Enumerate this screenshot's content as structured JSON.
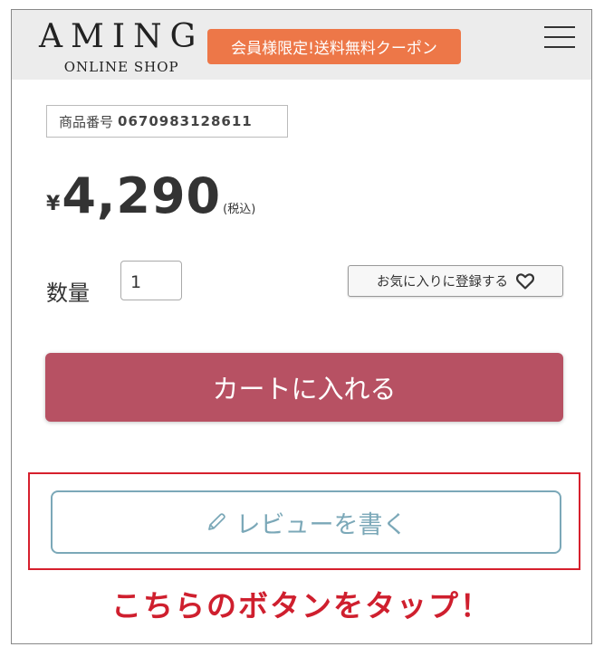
{
  "header": {
    "logo_main": "AMING",
    "logo_sub": "ONLINE SHOP",
    "coupon_label": "会員様限定!送料無料クーポン",
    "coupon_color": "#ed7748",
    "menu_icon": "hamburger-menu-icon"
  },
  "product": {
    "sku_label": "商品番号",
    "sku_value": "0670983128611",
    "price_currency": "¥",
    "price_value": "4,290",
    "price_tax": "(税込)"
  },
  "quantity": {
    "label": "数量",
    "value": "1"
  },
  "favorite": {
    "label": "お気に入りに登録する",
    "icon": "heart-icon"
  },
  "cart": {
    "label": "カートに入れる",
    "color": "#b75163"
  },
  "review": {
    "label": "レビューを書く",
    "icon": "pencil-icon",
    "border_color": "#7ba8b8"
  },
  "annotation": {
    "callout": "こちらのボタンをタップ！",
    "highlight_color": "#d6202d"
  }
}
